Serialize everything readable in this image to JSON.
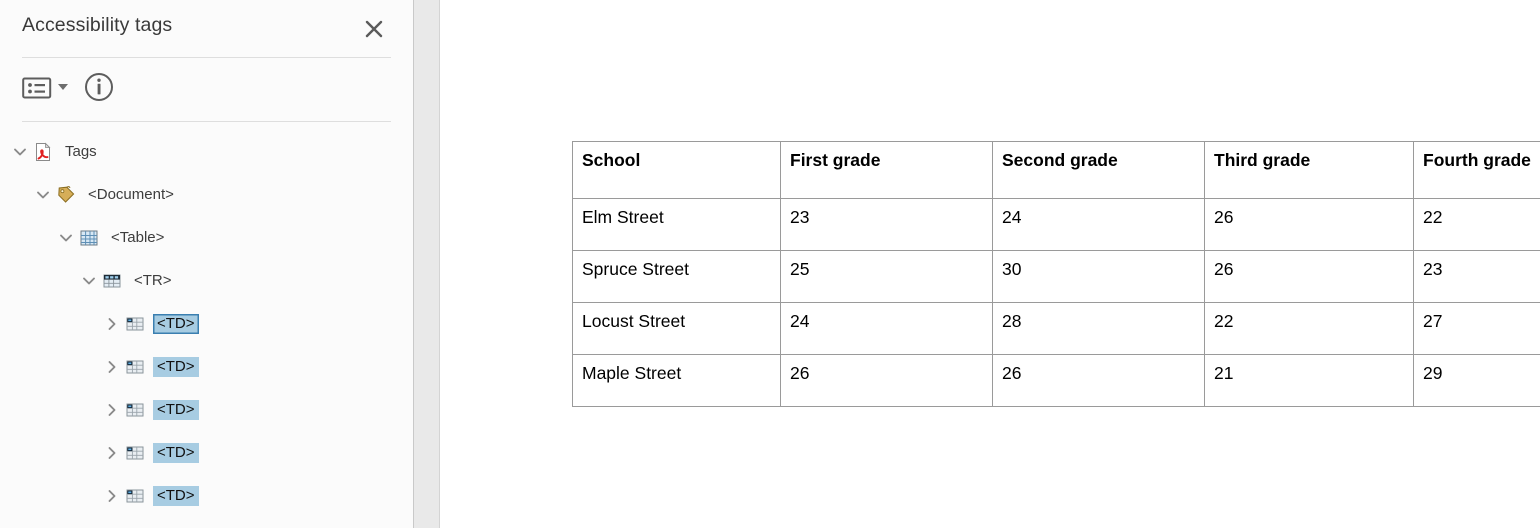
{
  "panel": {
    "title": "Accessibility tags",
    "close_icon": "close-icon",
    "toolbar": {
      "options_icon": "options-list-icon",
      "options_caret_icon": "chevron-down-icon",
      "info_icon": "info-circle-icon"
    },
    "tree": [
      {
        "label": "Tags",
        "icon": "pdf-file-icon",
        "depth": 0,
        "expanded": true,
        "selected": false,
        "focused": false
      },
      {
        "label": "<Document>",
        "icon": "tag-icon",
        "depth": 1,
        "expanded": true,
        "selected": false,
        "focused": false
      },
      {
        "label": "<Table>",
        "icon": "table-icon",
        "depth": 2,
        "expanded": true,
        "selected": false,
        "focused": false
      },
      {
        "label": "<TR>",
        "icon": "table-row-icon",
        "depth": 3,
        "expanded": true,
        "selected": false,
        "focused": false
      },
      {
        "label": "<TD>",
        "icon": "table-cell-icon",
        "depth": 4,
        "expanded": false,
        "selected": true,
        "focused": true
      },
      {
        "label": "<TD>",
        "icon": "table-cell-icon",
        "depth": 4,
        "expanded": false,
        "selected": true,
        "focused": false
      },
      {
        "label": "<TD>",
        "icon": "table-cell-icon",
        "depth": 4,
        "expanded": false,
        "selected": true,
        "focused": false
      },
      {
        "label": "<TD>",
        "icon": "table-cell-icon",
        "depth": 4,
        "expanded": false,
        "selected": true,
        "focused": false
      },
      {
        "label": "<TD>",
        "icon": "table-cell-icon",
        "depth": 4,
        "expanded": false,
        "selected": true,
        "focused": false
      }
    ]
  },
  "document": {
    "table": {
      "headers": [
        "School",
        "First grade",
        "Second grade",
        "Third grade",
        "Fourth grade"
      ],
      "rows": [
        [
          "Elm Street",
          "23",
          "24",
          "26",
          "22"
        ],
        [
          "Spruce Street",
          "25",
          "30",
          "26",
          "23"
        ],
        [
          "Locust Street",
          "24",
          "28",
          "22",
          "27"
        ],
        [
          "Maple Street",
          "26",
          "26",
          "21",
          "29"
        ]
      ]
    }
  },
  "colors": {
    "selection": "#a7cce2",
    "focus_border": "#3b7fb0",
    "panel_bg": "#fbfbfb",
    "table_border": "#9a9a9a"
  }
}
